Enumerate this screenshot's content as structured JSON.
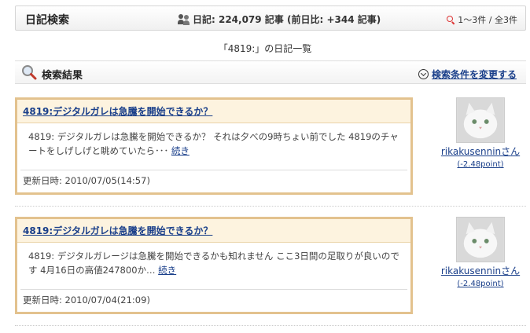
{
  "header": {
    "title": "日記検索",
    "stats": "日記: 224,079 記事 (前日比: +344 記事)",
    "count": "1〜3件 / 全3件"
  },
  "list_heading": "「4819:」の日記一覧",
  "results_bar": {
    "title": "検索結果",
    "change_link": "検索条件を変更する"
  },
  "entries": [
    {
      "title": "4819:デジタルガレは急騰を開始できるか？",
      "body": "4819: デジタルガレは急騰を開始できるか？ それは夕べの9時ちょい前でした 4819のチャートをしげしげと眺めていたら･･･",
      "more": "続き",
      "date": "更新日時: 2010/07/05(14:57)",
      "user": {
        "name": "rikakusenninさん",
        "point": "(-2.48point)"
      }
    },
    {
      "title": "4819:デジタルガレは急騰を開始できるか？",
      "body": "4819: デジタルガレージは急騰を開始できるかも知れません ここ3日間の足取りが良いのです 4月16日の高値247800か…",
      "more": "続き",
      "date": "更新日時: 2010/07/04(21:09)",
      "user": {
        "name": "rikakusenninさん",
        "point": "(-2.48point)"
      }
    }
  ],
  "colors": {
    "link": "#1a3f8a",
    "entry_border": "#e3c28e",
    "entry_title_bg": "#fdf3df"
  }
}
